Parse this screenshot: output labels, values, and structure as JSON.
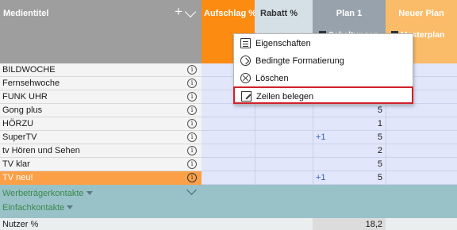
{
  "header": {
    "title": "Medientitel",
    "columns": [
      {
        "label": "Aufschlag %",
        "color": "#fc8b12"
      },
      {
        "label": "Rabatt %",
        "color": "#d4dfe6"
      },
      {
        "label": "Plan 1",
        "sub": "Schaltungen",
        "color": "#98a2ac"
      },
      {
        "label": "Neuer Plan",
        "sub": "Masterplan",
        "color": "#fbbc6a"
      }
    ]
  },
  "rows": [
    {
      "name": "BILDWOCHE",
      "delta": "",
      "value": ""
    },
    {
      "name": "Fernsehwoche",
      "delta": "",
      "value": ""
    },
    {
      "name": "FUNK UHR",
      "delta": "",
      "value": ""
    },
    {
      "name": "Gong plus",
      "delta": "",
      "value": "5"
    },
    {
      "name": "HÖRZU",
      "delta": "",
      "value": "1"
    },
    {
      "name": "SuperTV",
      "delta": "+1",
      "value": "5"
    },
    {
      "name": "tv Hören und Sehen",
      "delta": "",
      "value": "2"
    },
    {
      "name": "TV klar",
      "delta": "",
      "value": "5"
    },
    {
      "name": "TV neu!",
      "delta": "+1",
      "value": "5",
      "highlighted": true
    }
  ],
  "kontakte": {
    "werbetraeger": "Werbeträgerkontakte",
    "einfach": "Einfachkontakte"
  },
  "nutzer": {
    "label": "Nutzer %",
    "value": "18,2"
  },
  "context_menu": {
    "items": [
      {
        "label": "Eigenschaften",
        "icon": "document-icon"
      },
      {
        "label": "Bedingte Formatierung",
        "icon": "conditional-format-icon"
      },
      {
        "label": "Löschen",
        "icon": "delete-icon"
      },
      {
        "label": "Zeilen belegen",
        "icon": "edit-icon",
        "active": true
      }
    ]
  },
  "colors": {
    "highlight_row": "#fca048",
    "menu_active_border": "#d0202a",
    "delta_text": "#3a5cb0"
  }
}
